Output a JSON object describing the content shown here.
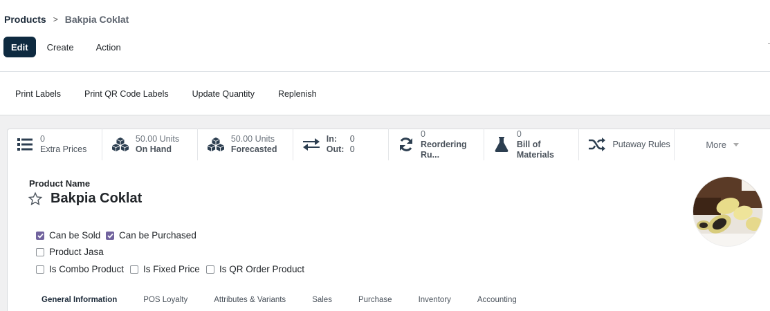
{
  "breadcrumb": {
    "parent": "Products",
    "separator": ">",
    "current": "Bakpia Coklat"
  },
  "actions": {
    "edit": "Edit",
    "create": "Create",
    "action": "Action"
  },
  "statusbar": {
    "buttons": [
      "Print Labels",
      "Print QR Code Labels",
      "Update Quantity",
      "Replenish"
    ]
  },
  "smart_buttons": {
    "extra_prices": {
      "value": "0",
      "label": "Extra Prices",
      "icon": "list-icon"
    },
    "on_hand": {
      "value": "50.00 Units",
      "label": "On Hand",
      "icon": "cubes-icon"
    },
    "forecasted": {
      "value": "50.00 Units",
      "label": "Forecasted",
      "icon": "cubes-icon"
    },
    "in_out": {
      "in_label": "In:",
      "in_value": "0",
      "out_label": "Out:",
      "out_value": "0",
      "icon": "exchange-icon"
    },
    "reordering": {
      "value": "0",
      "label": "Reordering Ru...",
      "icon": "refresh-icon"
    },
    "bom": {
      "value": "0",
      "label": "Bill of Materials",
      "icon": "flask-icon"
    },
    "putaway": {
      "label": "Putaway Rules",
      "icon": "random-icon"
    },
    "more": {
      "label": "More"
    }
  },
  "form": {
    "name_label": "Product Name",
    "name": "Bakpia Coklat",
    "checkboxes": {
      "can_be_sold": {
        "label": "Can be Sold",
        "checked": true
      },
      "can_be_purchased": {
        "label": "Can be Purchased",
        "checked": true
      },
      "product_jasa": {
        "label": "Product Jasa",
        "checked": false
      },
      "is_combo": {
        "label": "Is Combo Product",
        "checked": false
      },
      "is_fixed_price": {
        "label": "Is Fixed Price",
        "checked": false
      },
      "is_qr_order": {
        "label": "Is QR Order Product",
        "checked": false
      }
    }
  },
  "tabs": [
    "General Information",
    "POS Loyalty",
    "Attributes & Variants",
    "Sales",
    "Purchase",
    "Inventory",
    "Accounting"
  ],
  "colors": {
    "primary": "#0e2a40",
    "checkbox": "#71639e",
    "icon": "#2c3e50"
  }
}
